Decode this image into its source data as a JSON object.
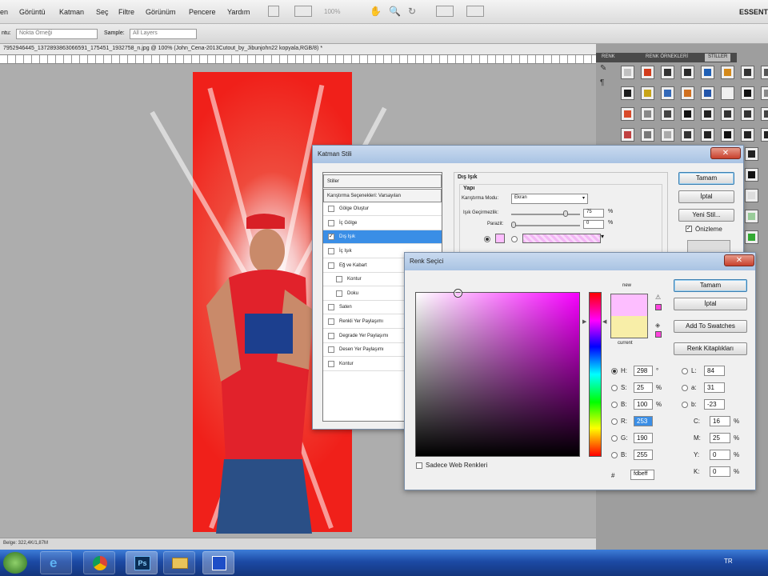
{
  "menu": {
    "items": [
      "en",
      "Görüntü",
      "Katman",
      "Seç",
      "Filtre",
      "Görünüm",
      "Pencere",
      "Yardım"
    ],
    "zoom": "100%",
    "workspace": "ESSENT"
  },
  "options_bar": {
    "mode_label": "ntu:",
    "mode_value": "Nokta Örneği",
    "sample_label": "Sample:",
    "sample_value": "All Layers"
  },
  "document": {
    "tab_title": "7952946445_1372893863066591_175451_1932758_n.jpg @ 100% (John_Cena-2013Cutout_by_Jibunjohn22 kopyala,RGB/8) *",
    "status": "Belge: 322,4K/1,87M"
  },
  "right_panel": {
    "tabs": [
      "RENK",
      "RENK ÖRNEKLERİ",
      "STİLLER"
    ],
    "active_tab": "STİLLER",
    "styles_colors": [
      "#c0c0c0",
      "#d23c1c",
      "#333",
      "#2a2a2a",
      "#1e5fb5",
      "#d4891a",
      "#333",
      "#555",
      "#1d1d1d",
      "#c8a417",
      "#3268b8",
      "#d07020",
      "#2255aa",
      "#f0f0f0",
      "#111",
      "#888",
      "#d84a2a",
      "#888",
      "#444",
      "#111",
      "#222",
      "#333",
      "#333",
      "#444",
      "#c04040",
      "#777",
      "#aaa",
      "#333",
      "#222",
      "#111",
      "#222",
      "#222"
    ],
    "side_colors": [
      "#222",
      "#111",
      "#ddd",
      "#9c9",
      "#3a3"
    ]
  },
  "layer_style": {
    "title": "Katman Stili",
    "list": [
      {
        "label": "Stiller",
        "checkbox": false,
        "indent": false,
        "selected": false
      },
      {
        "label": "Karıştırma Seçenekleri: Varsayılan",
        "checkbox": false,
        "indent": false,
        "selected": false
      },
      {
        "label": "Gölge Oluştur",
        "checkbox": true,
        "indent": false,
        "selected": false
      },
      {
        "label": "İç Gölge",
        "checkbox": true,
        "indent": false,
        "selected": false
      },
      {
        "label": "Dış Işık",
        "checkbox": true,
        "indent": false,
        "selected": true
      },
      {
        "label": "İç Işık",
        "checkbox": true,
        "indent": false,
        "selected": false
      },
      {
        "label": "Eğ ve Kabart",
        "checkbox": true,
        "indent": false,
        "selected": false
      },
      {
        "label": "Kontur",
        "checkbox": true,
        "indent": true,
        "selected": false
      },
      {
        "label": "Doku",
        "checkbox": true,
        "indent": true,
        "selected": false
      },
      {
        "label": "Saten",
        "checkbox": true,
        "indent": false,
        "selected": false
      },
      {
        "label": "Renkli Yer Paylaşımı",
        "checkbox": true,
        "indent": false,
        "selected": false
      },
      {
        "label": "Degrade Yer Paylaşımı",
        "checkbox": true,
        "indent": false,
        "selected": false
      },
      {
        "label": "Desen Yer Paylaşımı",
        "checkbox": true,
        "indent": false,
        "selected": false
      },
      {
        "label": "Kontur",
        "checkbox": true,
        "indent": false,
        "selected": false
      }
    ],
    "section_title": "Dış Işık",
    "group_title": "Yapı",
    "blend_mode_label": "Karıştırma Modu:",
    "blend_mode_value": "Ekran",
    "opacity_label": "Işık Geçirmezlik:",
    "opacity_value": "75",
    "noise_label": "Parazit:",
    "noise_value": "0",
    "percent": "%",
    "swatch_color": "#fdbeff",
    "buttons": {
      "ok": "Tamam",
      "cancel": "İptal",
      "new_style": "Yeni Stil...",
      "preview": "Önizleme"
    }
  },
  "color_picker": {
    "title": "Renk Seçici",
    "new_label": "new",
    "current_label": "current",
    "new_color": "#fdbeff",
    "current_color": "#f8eea8",
    "buttons": {
      "ok": "Tamam",
      "cancel": "İptal",
      "add_swatches": "Add To Swatches",
      "libraries": "Renk Kitaplıkları"
    },
    "web_only_label": "Sadece Web Renkleri",
    "hsb": [
      {
        "label": "H:",
        "value": "298",
        "unit": "°",
        "checked": true
      },
      {
        "label": "S:",
        "value": "25",
        "unit": "%",
        "checked": false
      },
      {
        "label": "B:",
        "value": "100",
        "unit": "%",
        "checked": false
      }
    ],
    "rgb": [
      {
        "label": "R:",
        "value": "253",
        "unit": "",
        "checked": false
      },
      {
        "label": "G:",
        "value": "190",
        "unit": "",
        "checked": false
      },
      {
        "label": "B:",
        "value": "255",
        "unit": "",
        "checked": false
      }
    ],
    "lab": [
      {
        "label": "L:",
        "value": "84",
        "unit": ""
      },
      {
        "label": "a:",
        "value": "31",
        "unit": ""
      },
      {
        "label": "b:",
        "value": "-23",
        "unit": ""
      }
    ],
    "cmyk": [
      {
        "label": "C:",
        "value": "16",
        "unit": "%"
      },
      {
        "label": "M:",
        "value": "25",
        "unit": "%"
      },
      {
        "label": "Y:",
        "value": "0",
        "unit": "%"
      },
      {
        "label": "K:",
        "value": "0",
        "unit": "%"
      }
    ],
    "hex_label": "#",
    "hex_value": "fdbeff",
    "hue_fraction": 0.17
  },
  "taskbar": {
    "tray_lang": "TR"
  }
}
